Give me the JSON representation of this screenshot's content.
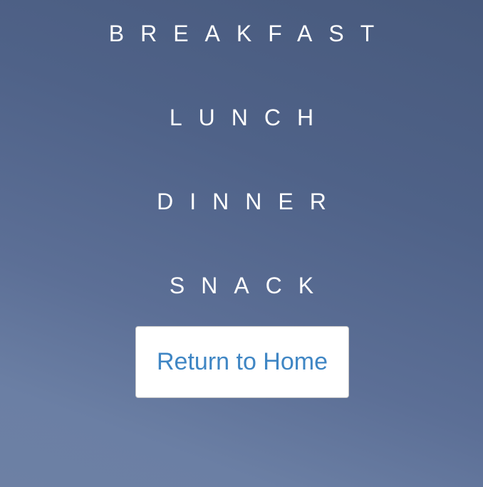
{
  "menu": {
    "items": [
      {
        "label": "BREAKFAST"
      },
      {
        "label": "LUNCH"
      },
      {
        "label": "DINNER"
      },
      {
        "label": "SNACK"
      }
    ]
  },
  "actions": {
    "return_home_label": "Return to Home"
  },
  "colors": {
    "background_top": "#485a7d",
    "background_bottom": "#6d80a4",
    "menu_text": "#ffffff",
    "button_background": "#ffffff",
    "button_text": "#3f86c4"
  }
}
